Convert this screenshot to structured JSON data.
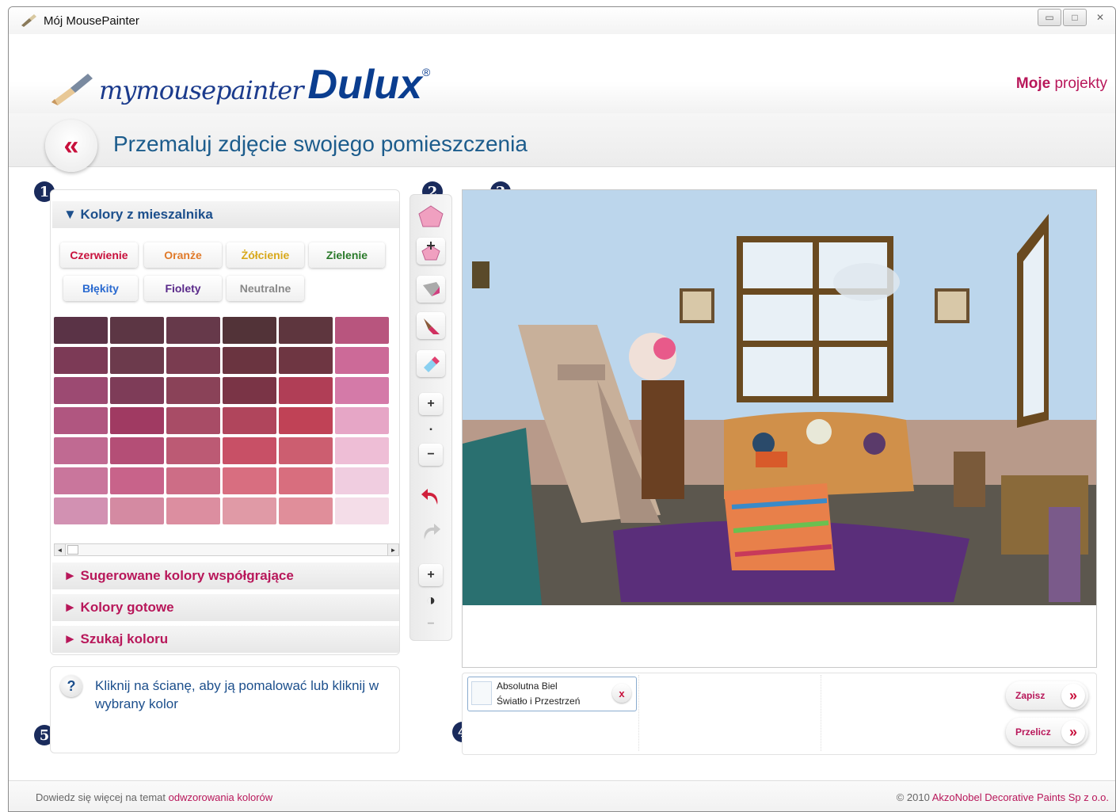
{
  "window": {
    "title": "Mój MousePainter"
  },
  "brand": {
    "logo_script": "mymousepainter",
    "logo_dulux": "Dulux",
    "logo_reg": "®",
    "my_projects_bold": "Moje",
    "my_projects_rest": " projekty"
  },
  "heading": {
    "back": "«",
    "title": "Przemaluj zdjęcie swojego pomieszczenia"
  },
  "steps": [
    "1",
    "2",
    "3",
    "4",
    "5"
  ],
  "left": {
    "open_section": "▼ Kolory z mieszalnika",
    "families": [
      {
        "label": "Czerwienie",
        "color": "#c8103c"
      },
      {
        "label": "Oranże",
        "color": "#e07a2a"
      },
      {
        "label": "Żółcienie",
        "color": "#d8a81a"
      },
      {
        "label": "Zielenie",
        "color": "#2a7a2a"
      },
      {
        "label": "Błękity",
        "color": "#2a6ad0"
      },
      {
        "label": "Fiolety",
        "color": "#5a2a8a"
      },
      {
        "label": "Neutralne",
        "color": "#888888"
      }
    ],
    "swatch_rows": [
      [
        "#5a3346",
        "#5c3644",
        "#66394a",
        "#523338",
        "#5e363e",
        "#b8557e"
      ],
      [
        "#7c3a56",
        "#6c3a4c",
        "#7a3c50",
        "#6a3440",
        "#6e3642",
        "#cc6a98"
      ],
      [
        "#9c4a72",
        "#7e3c58",
        "#8a4258",
        "#7a3446",
        "#b03e56",
        "#d47aa8"
      ],
      [
        "#b05680",
        "#a03a62",
        "#a84c66",
        "#b0455c",
        "#c04256",
        "#e6a6c6"
      ],
      [
        "#c06a92",
        "#b44e76",
        "#bc5a74",
        "#c85066",
        "#cc5e70",
        "#eebed6"
      ],
      [
        "#c9769c",
        "#c8638a",
        "#cd6d86",
        "#d86e80",
        "#d86e7e",
        "#f0cde0"
      ],
      [
        "#d291b2",
        "#d48aa2",
        "#dc8ea0",
        "#e09aa6",
        "#e08e9a",
        "#f4dde8"
      ]
    ],
    "collapsed_sections": [
      "► Sugerowane kolory współgrające",
      "► Kolory gotowe",
      "► Szukaj koloru"
    ],
    "scroll_left": "◄",
    "scroll_right": "►"
  },
  "help": {
    "icon": "?",
    "text": "Kliknij na ścianę, aby ją pomalować lub kliknij w wybrany kolor"
  },
  "tools": {
    "zoom_in": "+",
    "zoom_level": "▪",
    "zoom_out": "−",
    "contrast_plus": "+",
    "contrast_icon": "◑",
    "contrast_minus": "−"
  },
  "selected_color": {
    "line1": "Absolutna Biel",
    "line2": "Światło i Przestrzeń",
    "remove": "x",
    "swatch": "#f6f9fb"
  },
  "actions": {
    "save": "Zapisz",
    "calculate": "Przelicz",
    "chevron": "»"
  },
  "footer": {
    "left_text": "Dowiedz się więcej na temat ",
    "left_link": "odwzorowania kolorów",
    "right_text": "© 2010 ",
    "right_link": "AkzoNobel Decorative Paints Sp z o.o."
  },
  "colors": {
    "accent": "#b8175a",
    "heading_blue": "#1c5c8c",
    "wall": "#bcd6ec",
    "rug": "#5a2e7a"
  }
}
